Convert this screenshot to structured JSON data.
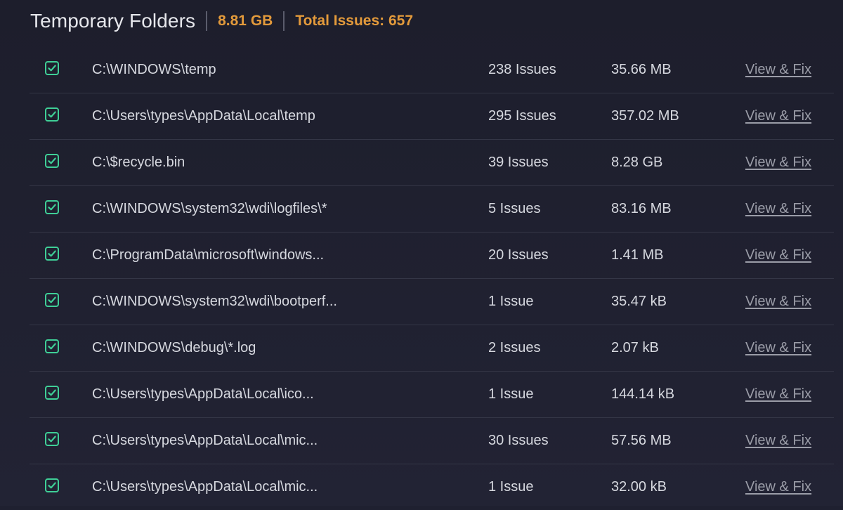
{
  "header": {
    "title": "Temporary Folders",
    "size": "8.81 GB",
    "total_issues": "Total Issues: 657"
  },
  "colors": {
    "accent_orange": "#e39a3b",
    "check_green": "#3fcf97",
    "background": "#1f2030"
  },
  "icons": {
    "checkbox": "checked-checkbox-icon"
  },
  "rows": [
    {
      "path": "C:\\WINDOWS\\temp",
      "issues": "238 Issues",
      "size": "35.66 MB",
      "action": "View & Fix",
      "checked": true
    },
    {
      "path": "C:\\Users\\types\\AppData\\Local\\temp",
      "issues": "295 Issues",
      "size": "357.02 MB",
      "action": "View & Fix",
      "checked": true
    },
    {
      "path": "C:\\$recycle.bin",
      "issues": "39 Issues",
      "size": "8.28 GB",
      "action": "View & Fix",
      "checked": true
    },
    {
      "path": "C:\\WINDOWS\\system32\\wdi\\logfiles\\*",
      "issues": "5 Issues",
      "size": "83.16 MB",
      "action": "View & Fix",
      "checked": true
    },
    {
      "path": "C:\\ProgramData\\microsoft\\windows...",
      "issues": "20 Issues",
      "size": "1.41 MB",
      "action": "View & Fix",
      "checked": true
    },
    {
      "path": "C:\\WINDOWS\\system32\\wdi\\bootperf...",
      "issues": "1 Issue",
      "size": "35.47 kB",
      "action": "View & Fix",
      "checked": true
    },
    {
      "path": "C:\\WINDOWS\\debug\\*.log",
      "issues": "2 Issues",
      "size": "2.07 kB",
      "action": "View & Fix",
      "checked": true
    },
    {
      "path": "C:\\Users\\types\\AppData\\Local\\ico...",
      "issues": "1 Issue",
      "size": "144.14 kB",
      "action": "View & Fix",
      "checked": true
    },
    {
      "path": "C:\\Users\\types\\AppData\\Local\\mic...",
      "issues": "30 Issues",
      "size": "57.56 MB",
      "action": "View & Fix",
      "checked": true
    },
    {
      "path": "C:\\Users\\types\\AppData\\Local\\mic...",
      "issues": "1 Issue",
      "size": "32.00 kB",
      "action": "View & Fix",
      "checked": true
    }
  ]
}
